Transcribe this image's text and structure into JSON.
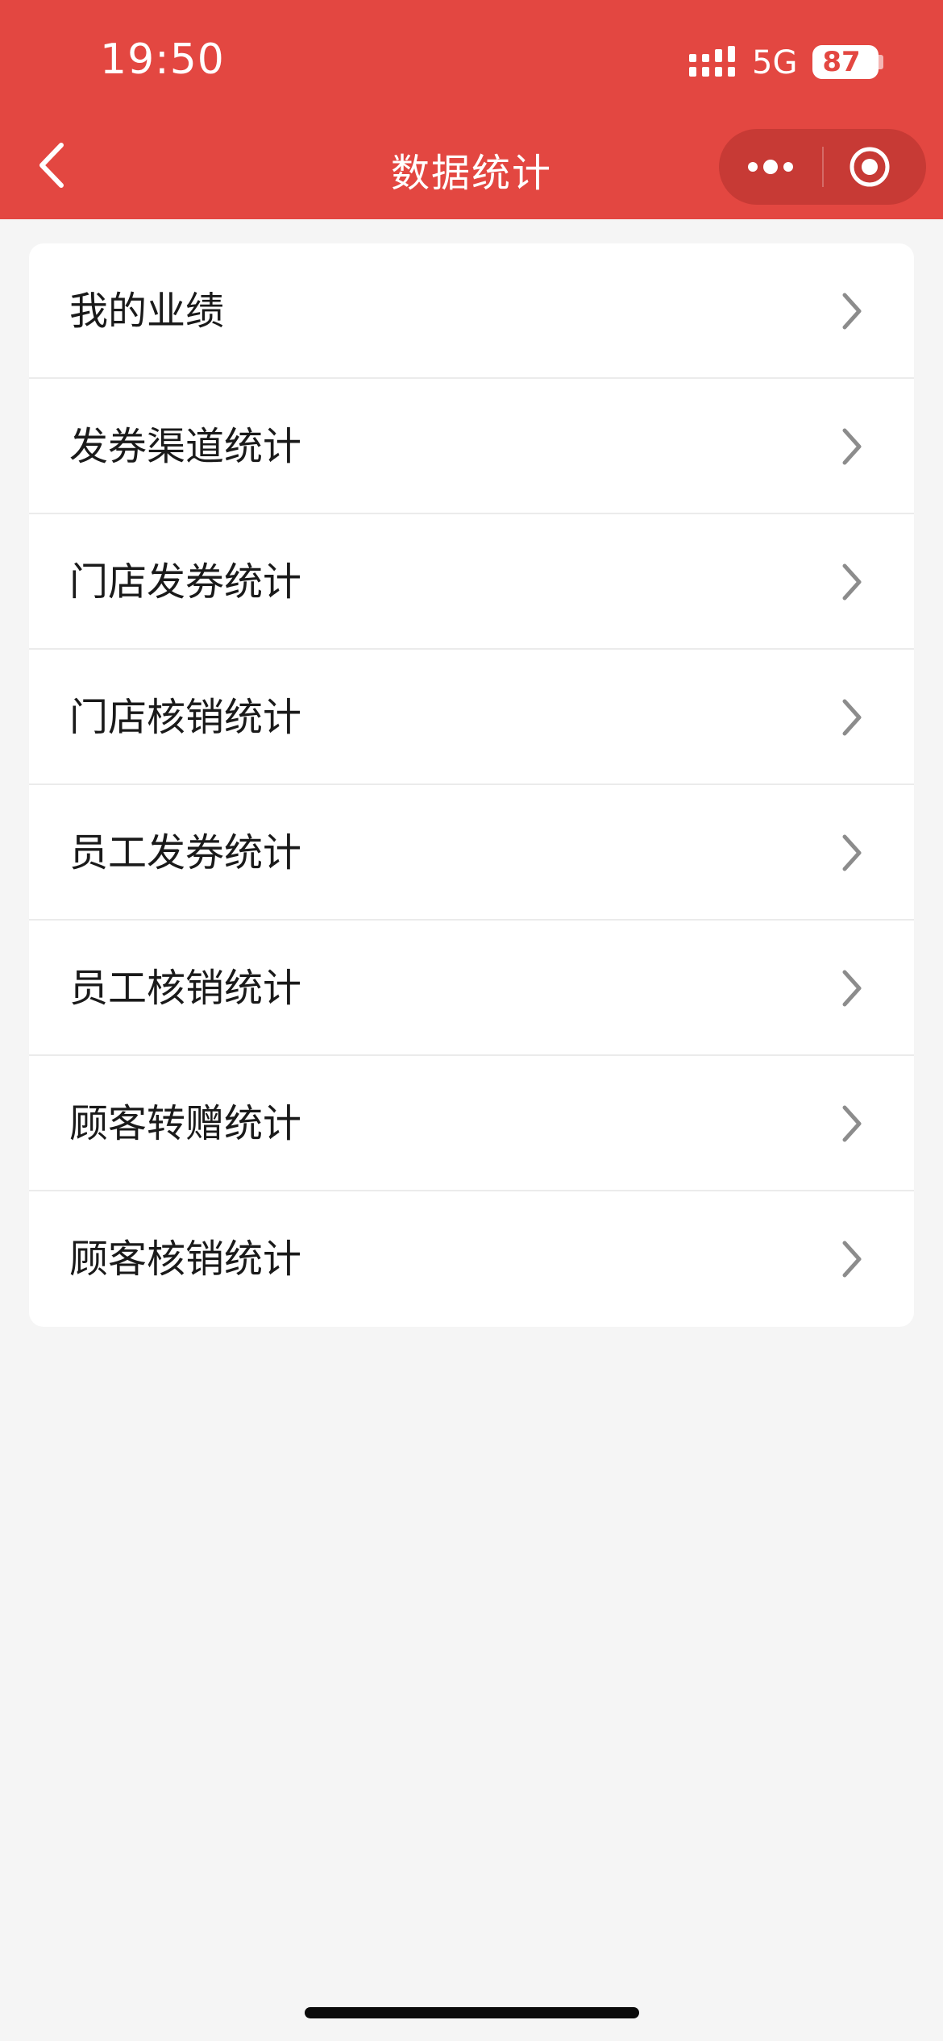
{
  "status_bar": {
    "time": "19:50",
    "network": "5G",
    "battery": "87"
  },
  "nav": {
    "title": "数据统计"
  },
  "menu": {
    "items": [
      {
        "label": "我的业绩"
      },
      {
        "label": "发券渠道统计"
      },
      {
        "label": "门店发券统计"
      },
      {
        "label": "门店核销统计"
      },
      {
        "label": "员工发券统计"
      },
      {
        "label": "员工核销统计"
      },
      {
        "label": "顾客转赠统计"
      },
      {
        "label": "顾客核销统计"
      }
    ]
  },
  "colors": {
    "header_bg": "#e34741",
    "capsule_bg": "#c73a35",
    "page_bg": "#f5f5f5",
    "card_bg": "#ffffff",
    "chevron": "#8c8c8c",
    "text": "#1a1a1a"
  },
  "icons": {
    "back": "chevron-left-icon",
    "more": "more-dots-icon",
    "close": "target-circle-icon",
    "item": "chevron-right-icon",
    "signal": "cellular-signal-icon",
    "battery": "battery-icon"
  }
}
